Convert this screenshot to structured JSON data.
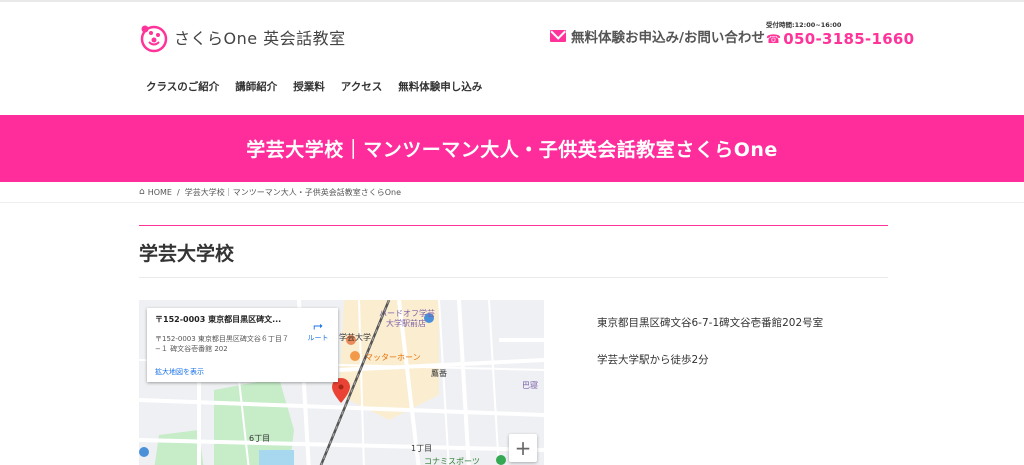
{
  "header": {
    "logo_text": "さくらOne 英会話教室",
    "contact_link": "無料体験お申込み/お問い合わせ",
    "phone_hours": "受付時間:12:00~16:00",
    "phone_icon": "☎",
    "phone_number": "050-3185-1660"
  },
  "nav": {
    "items": [
      "クラスのご紹介",
      "講師紹介",
      "授業料",
      "アクセス",
      "無料体験申し込み"
    ]
  },
  "banner": {
    "title": "学芸大学校｜マンツーマン大人・子供英会話教室さくらOne"
  },
  "breadcrumb": {
    "home": "HOME",
    "separator": "/",
    "current": "学芸大学校｜マンツーマン大人・子供英会話教室さくらOne"
  },
  "page": {
    "title": "学芸大学校"
  },
  "map": {
    "card_title": "〒152-0003 東京都目黒区碑文...",
    "card_address": "〒152-0003 東京都目黒区碑文谷６丁目７−１ 碑文谷壱番館 202",
    "card_link": "拡大地図を表示",
    "route_label": "ルート",
    "zoom_in": "+",
    "labels": {
      "hardoff": "ハードオフ学芸",
      "hardoff2": "大学駅前店",
      "gakugei": "学芸大学",
      "matter": "マッターホーン",
      "takaban": "鷹番",
      "chome6": "6丁目",
      "chome1": "1丁目",
      "konami": "コナミスポーツ",
      "tomoe": "巴寝"
    }
  },
  "info": {
    "address": "東京都目黒区碑文谷6-7-1碑文谷壱番館202号室",
    "access": "学芸大学駅から徒歩2分"
  },
  "colors": {
    "accent": "#ff2d9c",
    "link": "#1a73e8"
  }
}
